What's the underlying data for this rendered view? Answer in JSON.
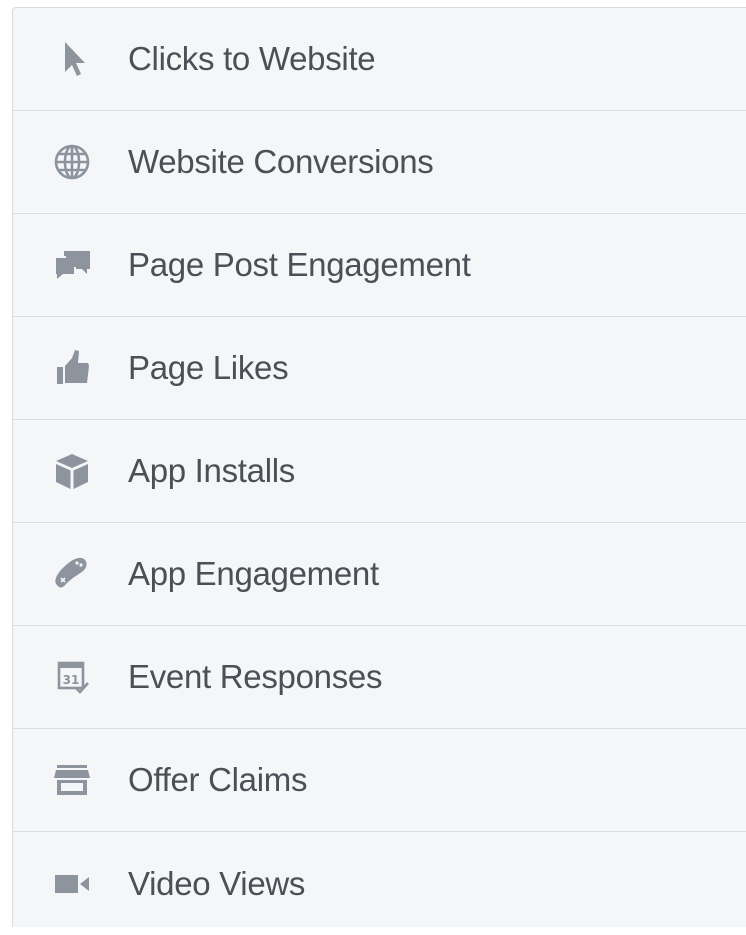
{
  "colors": {
    "background": "#f5f6f8",
    "divider": "#dadde1",
    "icon": "#8d949e",
    "text": "#4b4f56"
  },
  "objectives": [
    {
      "label": "Clicks to Website",
      "icon": "cursor-icon"
    },
    {
      "label": "Website Conversions",
      "icon": "globe-icon"
    },
    {
      "label": "Page Post Engagement",
      "icon": "chat-bubbles-icon"
    },
    {
      "label": "Page Likes",
      "icon": "thumbs-up-icon"
    },
    {
      "label": "App Installs",
      "icon": "box-icon"
    },
    {
      "label": "App Engagement",
      "icon": "game-controller-icon"
    },
    {
      "label": "Event Responses",
      "icon": "calendar-check-icon"
    },
    {
      "label": "Offer Claims",
      "icon": "storefront-icon"
    },
    {
      "label": "Video Views",
      "icon": "video-camera-icon"
    }
  ]
}
